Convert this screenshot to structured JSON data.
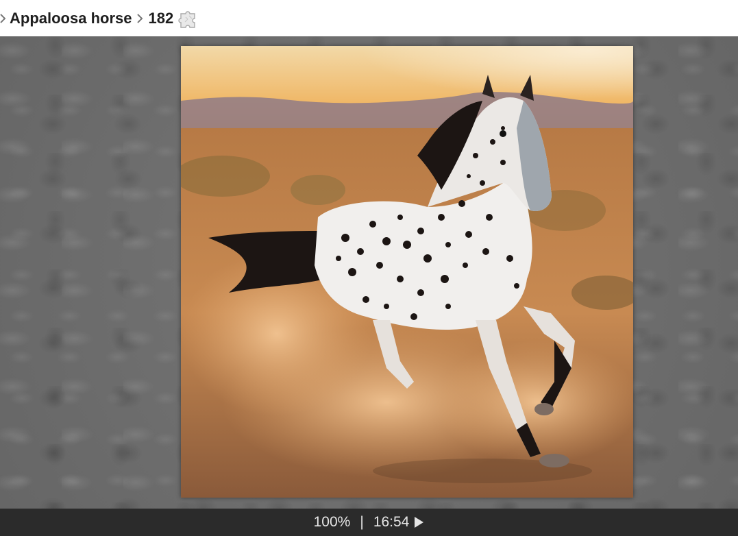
{
  "breadcrumb": {
    "category": "Appaloosa horse",
    "puzzle_number": "182"
  },
  "icons": {
    "leading_separator": "chevron-right-icon",
    "separator": "chevron-right-icon",
    "puzzle": "puzzle-piece-icon",
    "play": "play-icon"
  },
  "status": {
    "zoom": "100%",
    "divider": "|",
    "timer": "16:54"
  },
  "colors": {
    "header_bg": "#ffffff",
    "stage_bg": "#6e6e6e",
    "statusbar_bg": "#2b2b2b",
    "statusbar_text": "#e6e6e6"
  }
}
